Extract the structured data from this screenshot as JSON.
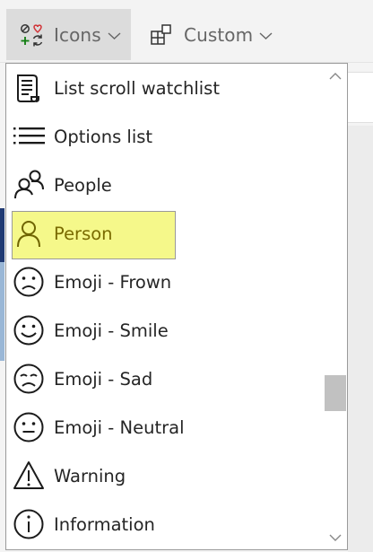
{
  "ribbon": {
    "icons_label": "Icons",
    "custom_label": "Custom"
  },
  "dropdown": {
    "items": [
      {
        "label": "List scroll watchlist",
        "icon": "list-scroll-watchlist-icon"
      },
      {
        "label": "Options list",
        "icon": "options-list-icon"
      },
      {
        "label": "People",
        "icon": "people-icon"
      },
      {
        "label": "Person",
        "icon": "person-icon"
      },
      {
        "label": "Emoji - Frown",
        "icon": "emoji-frown-icon"
      },
      {
        "label": "Emoji - Smile",
        "icon": "emoji-smile-icon"
      },
      {
        "label": "Emoji - Sad",
        "icon": "emoji-sad-icon"
      },
      {
        "label": "Emoji - Neutral",
        "icon": "emoji-neutral-icon"
      },
      {
        "label": "Warning",
        "icon": "warning-icon"
      },
      {
        "label": "Information",
        "icon": "information-icon"
      }
    ],
    "selected_label": "Person",
    "scroll_position": 0.75
  },
  "colors": {
    "highlight": "#f5f88a",
    "selected_text": "#7a6b00",
    "ribbon_active": "#dcdcdc"
  }
}
